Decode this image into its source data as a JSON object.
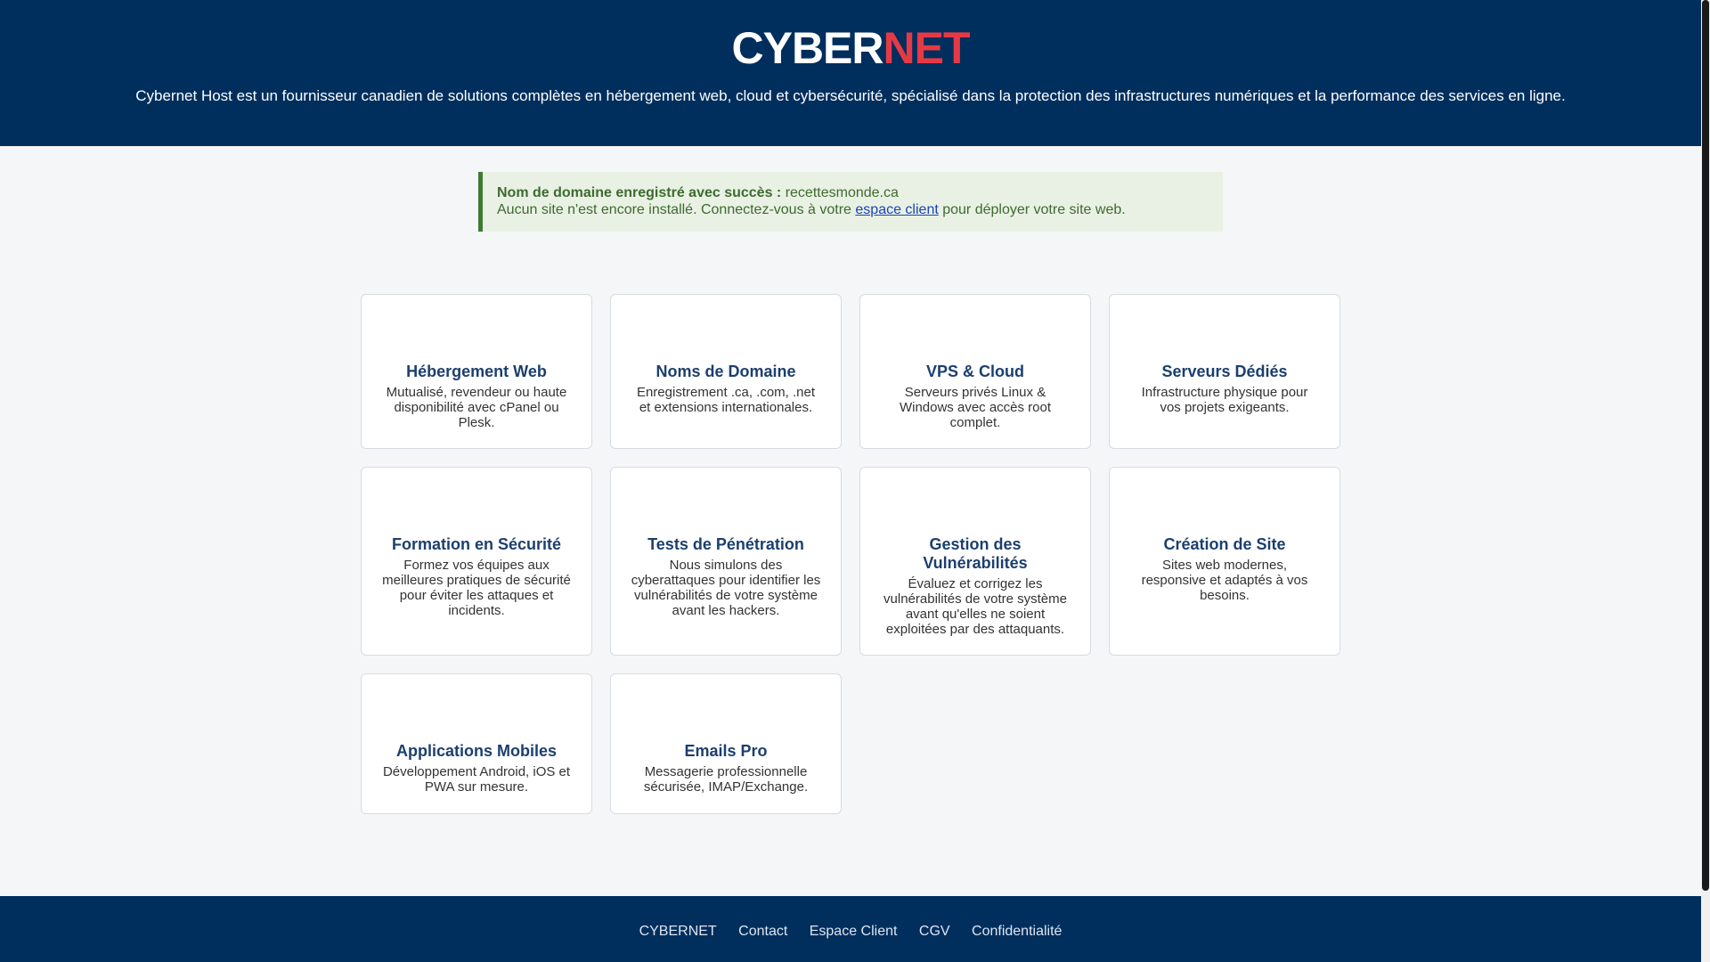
{
  "header": {
    "logo_part1": "CYBER",
    "logo_part2": "NET",
    "tagline": "Cybernet Host est un fournisseur canadien de solutions complètes en hébergement web, cloud et cybersécurité, spécialisé dans la protection des infrastructures numériques et la performance des services en ligne."
  },
  "alert": {
    "strong": "Nom de domaine enregistré avec succès :",
    "domain": "recettesmonde.ca",
    "line2_before": "Aucun site n'est encore installé. Connectez-vous à votre",
    "link": "espace client",
    "line2_after": "pour déployer votre site web."
  },
  "services": [
    {
      "title": "Hébergement Web",
      "desc": "Mutualisé, revendeur ou haute disponibilité avec cPanel ou Plesk."
    },
    {
      "title": "Noms de Domaine",
      "desc": "Enregistrement .ca, .com, .net et extensions internationales."
    },
    {
      "title": "VPS & Cloud",
      "desc": "Serveurs privés Linux & Windows avec accès root complet."
    },
    {
      "title": "Serveurs Dédiés",
      "desc": "Infrastructure physique pour vos projets exigeants."
    },
    {
      "title": "Formation en Sécurité",
      "desc": "Formez vos équipes aux meilleures pratiques de sécurité pour éviter les attaques et incidents."
    },
    {
      "title": "Tests de Pénétration",
      "desc": "Nous simulons des cyberattaques pour identifier les vulnérabilités de votre système avant les hackers."
    },
    {
      "title": "Gestion des Vulnérabilités",
      "desc": "Évaluez et corrigez les vulnérabilités de votre système avant qu'elles ne soient exploitées par des attaquants."
    },
    {
      "title": "Création de Site",
      "desc": "Sites web modernes, responsive et adaptés à vos besoins."
    },
    {
      "title": "Applications Mobiles",
      "desc": "Développement Android, iOS et PWA sur mesure."
    },
    {
      "title": "Emails Pro",
      "desc": "Messagerie professionnelle sécurisée, IMAP/Exchange."
    }
  ],
  "footer": {
    "links": [
      "CYBERNET",
      "Contact",
      "Espace Client",
      "CGV",
      "Confidentialité"
    ]
  },
  "colors": {
    "brand_navy": "#002e5d",
    "logo_red": "#e63946",
    "alert_green": "#3f7a35",
    "card_title": "#1c3f6e"
  }
}
